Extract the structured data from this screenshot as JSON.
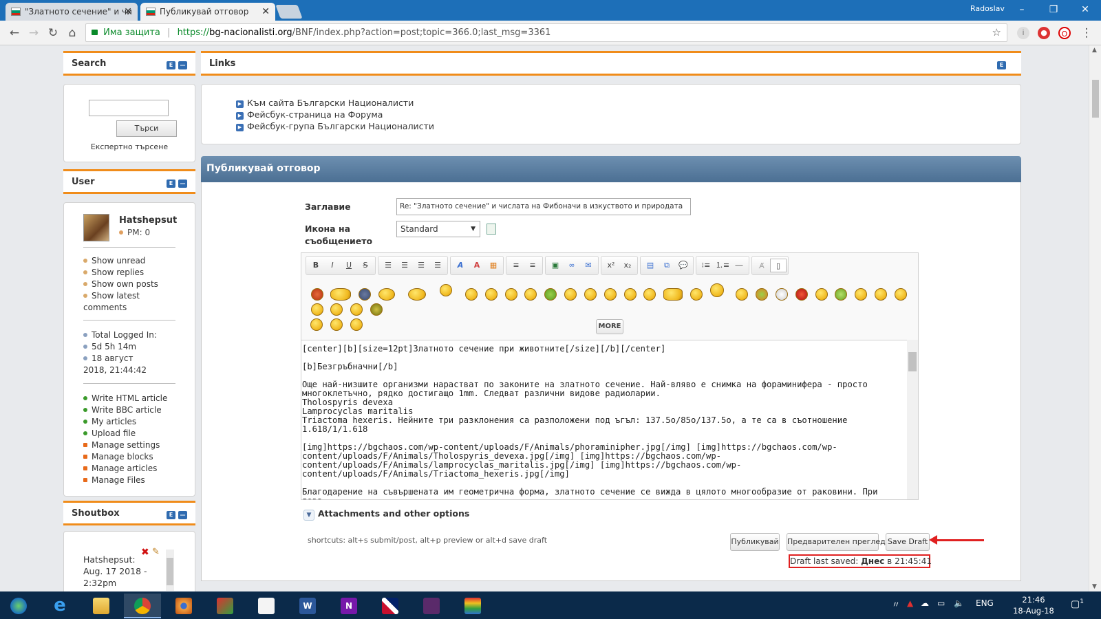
{
  "browser": {
    "tabs": [
      {
        "label": "\"Златното сечение\" и чи",
        "active": false
      },
      {
        "label": "Публикувай отговор",
        "active": true
      }
    ],
    "user": "Radoslav",
    "security_label": "Има защита",
    "url_scheme": "https://",
    "url_domain": "bg-nacionalisti.org",
    "url_path": "/BNF/index.php?action=post;topic=366.0;last_msg=3361"
  },
  "sidebar": {
    "search": {
      "title": "Search",
      "button_label": "Търси",
      "advanced_label": "Експертно търсене",
      "input_value": ""
    },
    "user_block": {
      "title": "User",
      "name": "Hatshepsut",
      "pm": "PM: 0",
      "links1": [
        "Show unread",
        "Show replies",
        "Show own posts",
        "Show latest comments"
      ],
      "stats": [
        "Total Logged In:",
        "5d 5h 14m",
        "18 август 2018, 21:44:42"
      ],
      "links2": [
        "Write HTML article",
        "Write BBC article",
        "My articles",
        "Upload file"
      ],
      "links3": [
        "Manage settings",
        "Manage blocks",
        "Manage articles",
        "Manage Files"
      ]
    },
    "shoutbox": {
      "title": "Shoutbox",
      "author": "Hatshepsut:",
      "date": "Aug. 17 2018 -",
      "time": "2:32pm"
    }
  },
  "links_block": {
    "title": "Links",
    "items": [
      "Към сайта Български Националисти",
      "Фейсбук-страница на Форума",
      "Фейсбук-група Български Националисти"
    ]
  },
  "post_form": {
    "title": "Публикувай отговор",
    "subject_label": "Заглавие",
    "subject_value": "Re: \"Златното сечение\" и числата на Фибоначи в изкуството и природата",
    "icon_label_1": "Икона на",
    "icon_label_2": "съобщението",
    "icon_value": "Standard",
    "more_label": "MORE",
    "body_lines": [
      "[center][b][size=12pt]Златното сечение при животните[/size][/b][/center]",
      "[b]Безгръбначни[/b]",
      "Още най-низшите организми нарастват по законите на златното сечение. Най-вляво е снимка на фораминифера - просто\nмногоклетъчно, рядко достигащо 1mm. Следват различни видове радиоларии.\nTholospyris devexa\nLamprocyclas maritalis\nTriactoma hexeris. Нейните три разклонения са разположени под ъгъл: 137.5o/85o/137.5o, а те са в съотношение 1.618/1/1.618",
      "[img]https://bgchaos.com/wp-content/uploads/F/Animals/phoraminipher.jpg[/img] [img]https://bgchaos.com/wp-\ncontent/uploads/F/Animals/Tholospyris_devexa.jpg[/img] [img]https://bgchaos.com/wp-\ncontent/uploads/F/Animals/lamprocyclas_maritalis.jpg[/img] [img]https://bgchaos.com/wp-\ncontent/uploads/F/Animals/Triactoma_hexeris.jpg[/img]",
      "Благодарение на съвършената им геометрична форма, златното сечение се вижда в цялото многообразие от раковини. При това,\nпризнаците на хармоничност се изразяват не приблизително, а почти точно."
    ],
    "attachments_label": "Attachments and other options",
    "shortcuts": "shortcuts: alt+s submit/post, alt+p preview or alt+d save draft",
    "submit_label": "Публикувай",
    "preview_label": "Предварителен преглед",
    "save_draft_label": "Save Draft",
    "draft_prefix": "Draft last saved:",
    "draft_day": "Днес",
    "draft_mid": "в",
    "draft_time": "21:45:41"
  },
  "taskbar": {
    "lang": "ENG",
    "time": "21:46",
    "date": "18-Aug-18",
    "notifications": "1"
  }
}
